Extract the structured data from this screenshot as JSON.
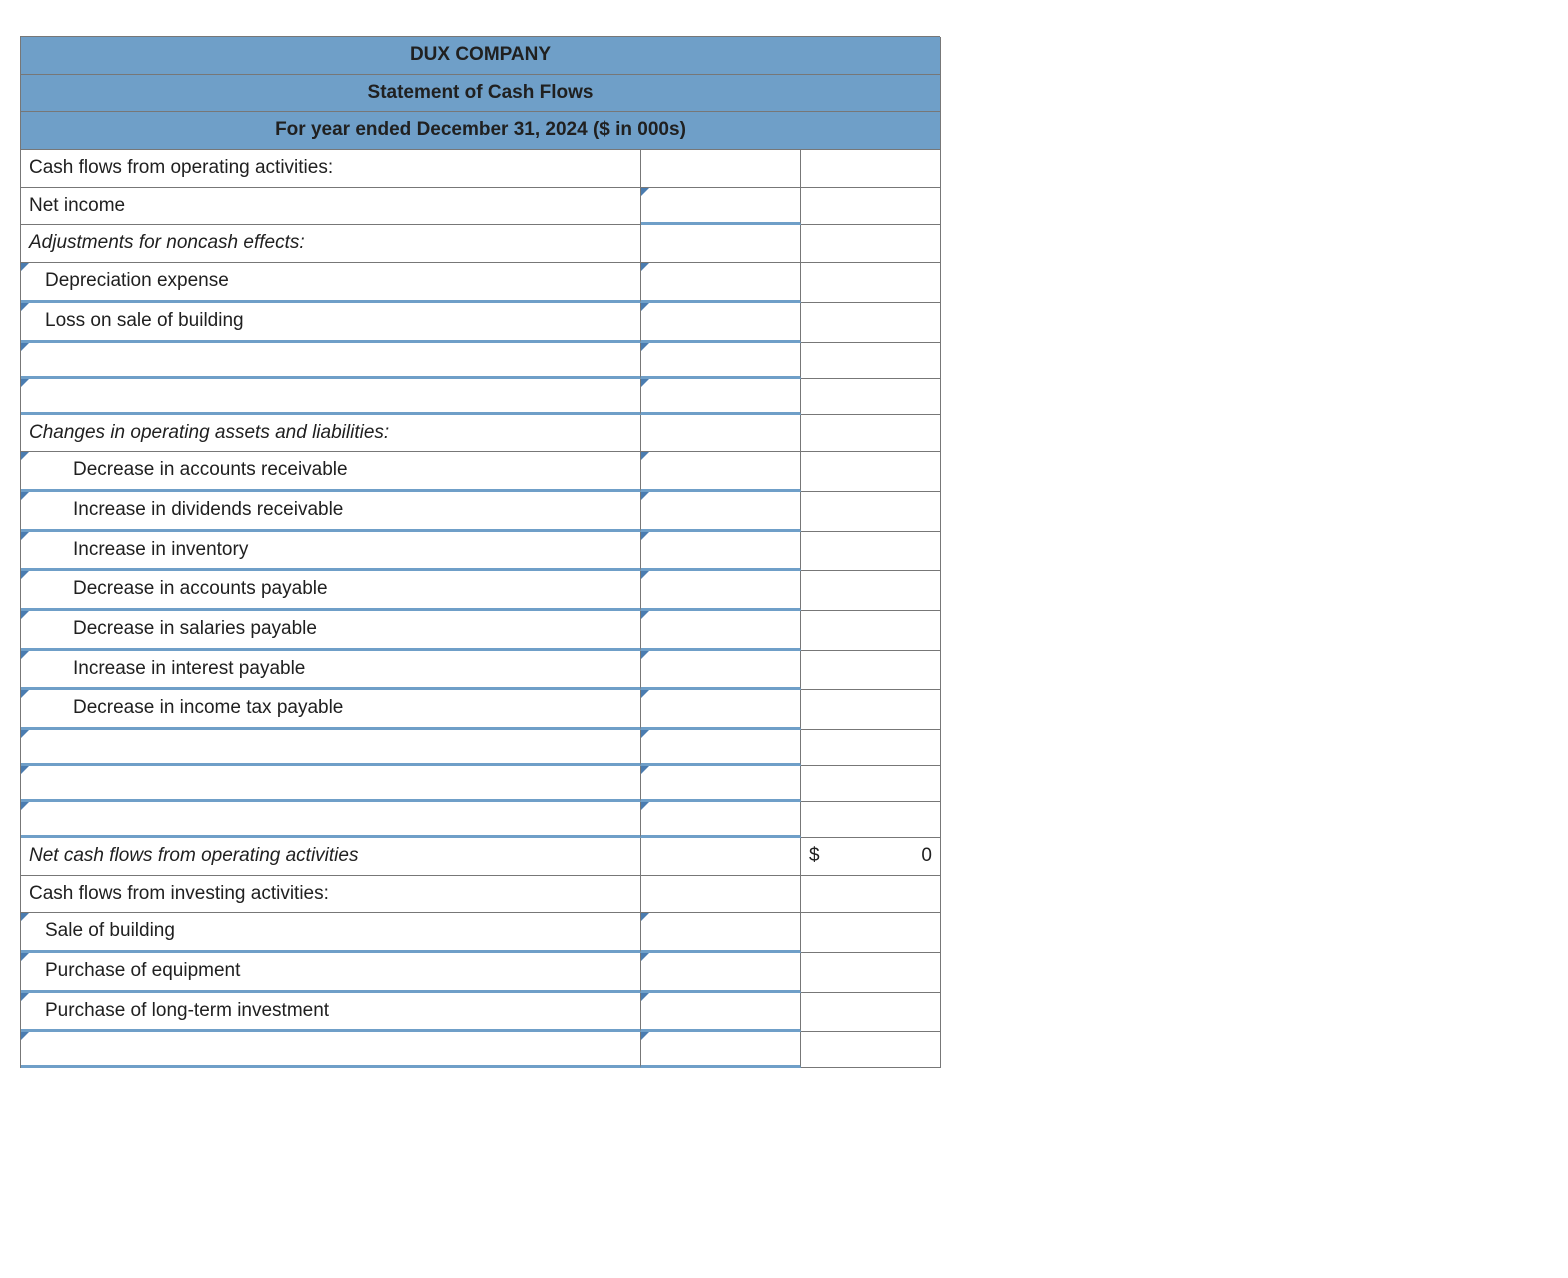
{
  "header": {
    "company": "DUX COMPANY",
    "title": "Statement of Cash Flows",
    "period": "For year ended December 31, 2024 ($ in 000s)"
  },
  "totals": {
    "net_operating_currency": "$",
    "net_operating_value": "0"
  },
  "rows": [
    {
      "label": "Cash flows from operating activities:",
      "labelClass": "",
      "labelDD": false,
      "valDD": false,
      "hasTotal": false
    },
    {
      "label": "Net income",
      "labelClass": "",
      "labelDD": false,
      "valDD": true,
      "hasTotal": false
    },
    {
      "label": "Adjustments for noncash effects:",
      "labelClass": "italic",
      "labelDD": false,
      "valDD": false,
      "hasTotal": false
    },
    {
      "label": "Depreciation expense",
      "labelClass": "ind1",
      "labelDD": true,
      "valDD": true,
      "hasTotal": false
    },
    {
      "label": "Loss on sale of building",
      "labelClass": "ind1",
      "labelDD": true,
      "valDD": true,
      "hasTotal": false
    },
    {
      "label": "",
      "labelClass": "",
      "labelDD": true,
      "valDD": true,
      "hasTotal": false
    },
    {
      "label": "",
      "labelClass": "",
      "labelDD": true,
      "valDD": true,
      "hasTotal": false
    },
    {
      "label": "Changes in operating assets and liabilities:",
      "labelClass": "italic",
      "labelDD": false,
      "valDD": false,
      "hasTotal": false
    },
    {
      "label": "Decrease in accounts receivable",
      "labelClass": "ind2",
      "labelDD": true,
      "valDD": true,
      "hasTotal": false
    },
    {
      "label": "Increase in dividends receivable",
      "labelClass": "ind2",
      "labelDD": true,
      "valDD": true,
      "hasTotal": false
    },
    {
      "label": "Increase in inventory",
      "labelClass": "ind2",
      "labelDD": true,
      "valDD": true,
      "hasTotal": false
    },
    {
      "label": "Decrease in accounts payable",
      "labelClass": "ind2",
      "labelDD": true,
      "valDD": true,
      "hasTotal": false
    },
    {
      "label": "Decrease in salaries payable",
      "labelClass": "ind2",
      "labelDD": true,
      "valDD": true,
      "hasTotal": false
    },
    {
      "label": "Increase in interest payable",
      "labelClass": "ind2",
      "labelDD": true,
      "valDD": true,
      "hasTotal": false
    },
    {
      "label": "Decrease in income tax payable",
      "labelClass": "ind2",
      "labelDD": true,
      "valDD": true,
      "hasTotal": false
    },
    {
      "label": "",
      "labelClass": "",
      "labelDD": true,
      "valDD": true,
      "hasTotal": false
    },
    {
      "label": "",
      "labelClass": "",
      "labelDD": true,
      "valDD": true,
      "hasTotal": false
    },
    {
      "label": "",
      "labelClass": "",
      "labelDD": true,
      "valDD": true,
      "hasTotal": false
    },
    {
      "label": "Net cash flows from operating activities",
      "labelClass": "italic",
      "labelDD": false,
      "valDD": false,
      "hasTotal": true
    },
    {
      "label": "Cash flows from investing activities:",
      "labelClass": "",
      "labelDD": false,
      "valDD": false,
      "hasTotal": false
    },
    {
      "label": "Sale of building",
      "labelClass": "ind1",
      "labelDD": true,
      "valDD": true,
      "hasTotal": false
    },
    {
      "label": "Purchase of equipment",
      "labelClass": "ind1",
      "labelDD": true,
      "valDD": true,
      "hasTotal": false
    },
    {
      "label": "Purchase of long-term investment",
      "labelClass": "ind1",
      "labelDD": true,
      "valDD": true,
      "hasTotal": false
    },
    {
      "label": "",
      "labelClass": "",
      "labelDD": true,
      "valDD": true,
      "hasTotal": false
    }
  ]
}
